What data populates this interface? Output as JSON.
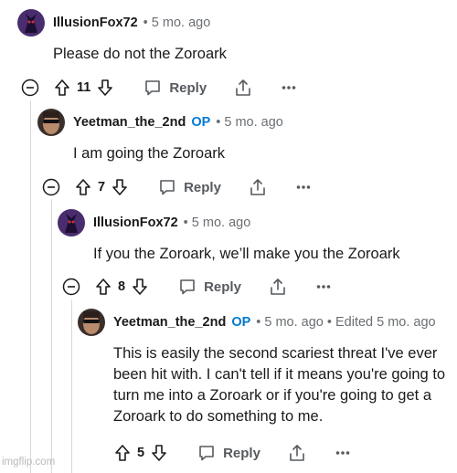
{
  "icons": {
    "collapse": "minus-circle-icon",
    "upvote": "arrow-up-icon",
    "downvote": "arrow-down-icon",
    "reply": "speech-bubble-icon",
    "share": "share-icon",
    "more": "ellipsis-icon"
  },
  "colors": {
    "op_badge": "#0079d3",
    "meta_text": "#6b6f73",
    "thread_line": "#d8d8d8"
  },
  "comments": [
    {
      "author": "IllusionFox72",
      "op_badge": "",
      "meta": "• 5 mo. ago",
      "body": "Please do not the Zoroark",
      "score": "11",
      "reply_label": "Reply"
    },
    {
      "author": "Yeetman_the_2nd",
      "op_badge": "OP",
      "meta": "• 5 mo. ago",
      "body": "I am going the Zoroark",
      "score": "7",
      "reply_label": "Reply"
    },
    {
      "author": "IllusionFox72",
      "op_badge": "",
      "meta": "• 5 mo. ago",
      "body": "If you the Zoroark, we’ll make you the Zoroark",
      "score": "8",
      "reply_label": "Reply"
    },
    {
      "author": "Yeetman_the_2nd",
      "op_badge": "OP",
      "meta": "• 5 mo. ago • Edited 5 mo. ago",
      "body": "This is easily the second scariest threat I've ever been hit with. I can't tell if it means you're going to turn me into a Zoroark or if you're going to get a Zoroark to do something to me.",
      "score": "5",
      "reply_label": "Reply"
    }
  ],
  "watermark": "imgflip.com"
}
